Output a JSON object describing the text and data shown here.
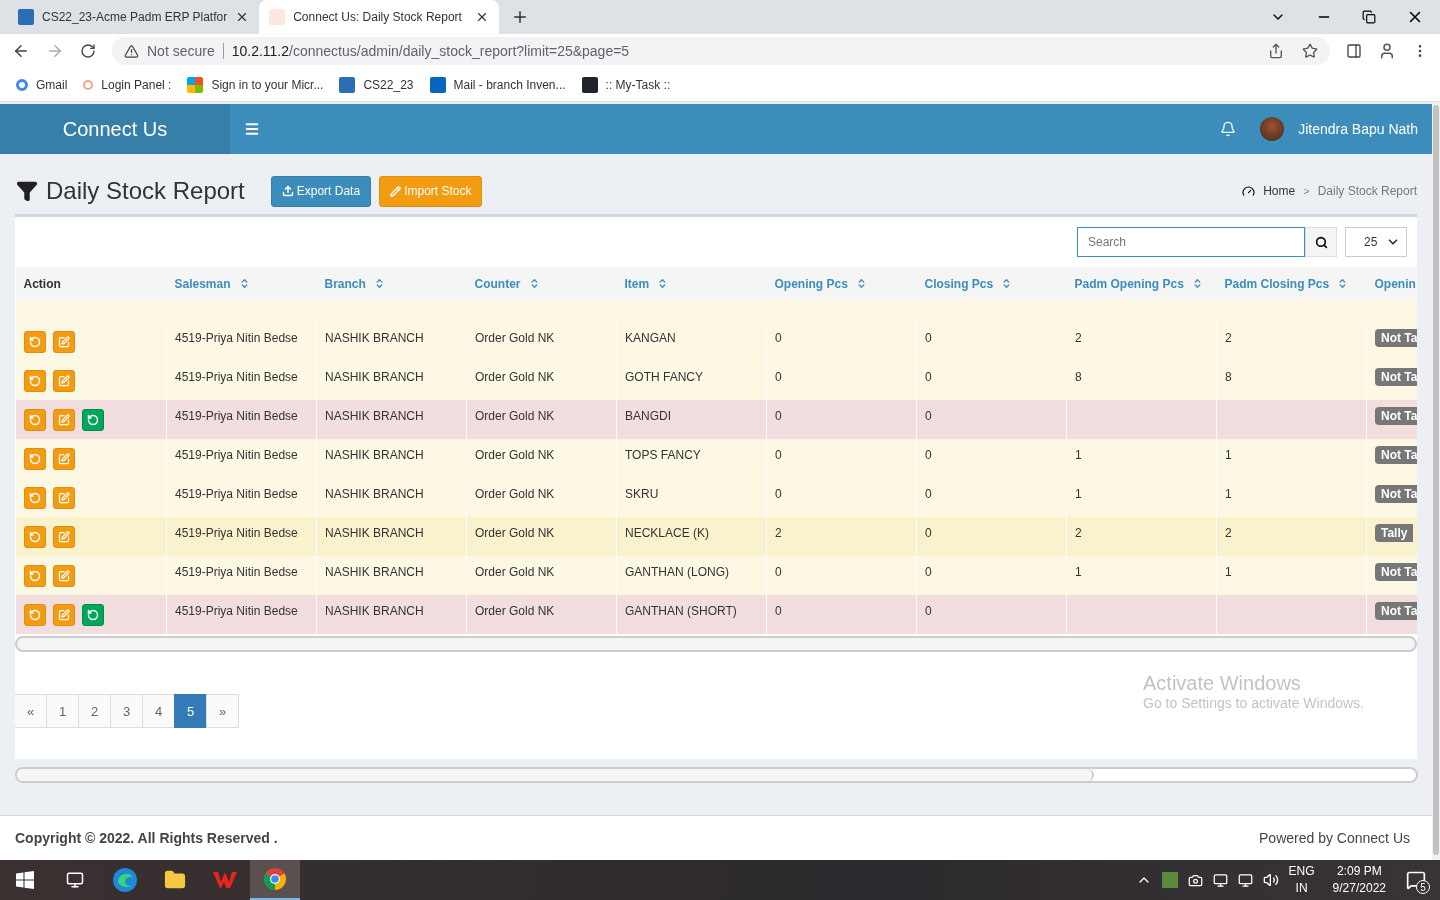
{
  "browser": {
    "tabs": [
      {
        "title": "CS22_23-Acme Padm ERP Platfor",
        "selected": false
      },
      {
        "title": "Connect Us: Daily Stock Report",
        "selected": true
      }
    ],
    "security": "Not secure",
    "url_host": "10.2.11.2",
    "url_path": "/connectus/admin/daily_stock_report?limit=25&page=5",
    "bookmarks": [
      {
        "label": "Gmail",
        "kind": "google"
      },
      {
        "label": "Login Panel :",
        "kind": "connect"
      },
      {
        "label": "Sign in to your Micr...",
        "kind": "microsoft"
      },
      {
        "label": "CS22_23",
        "kind": "erp"
      },
      {
        "label": "Mail - branch Inven...",
        "kind": "outlook"
      },
      {
        "label": ":: My-Task ::",
        "kind": "react"
      }
    ]
  },
  "app": {
    "brand": "Connect Us",
    "user": "Jitendra Bapu Nath"
  },
  "page": {
    "title": "Daily Stock Report",
    "buttons": [
      {
        "label": "Export Data",
        "kind": "export"
      },
      {
        "label": "Import Stock",
        "kind": "import"
      }
    ],
    "breadcrumb": [
      {
        "label": "Home"
      },
      {
        "label": "Daily Stock Report"
      }
    ],
    "breadcrumb_separator": ">"
  },
  "table": {
    "search_placeholder": "Search",
    "page_size": "25",
    "columns": [
      {
        "label": "Action",
        "sortable": false
      },
      {
        "label": "Salesman",
        "sortable": true
      },
      {
        "label": "Branch",
        "sortable": true
      },
      {
        "label": "Counter",
        "sortable": true
      },
      {
        "label": "Item",
        "sortable": true
      },
      {
        "label": "Opening Pcs",
        "sortable": true
      },
      {
        "label": "Closing Pcs",
        "sortable": true
      },
      {
        "label": "Padm Opening Pcs",
        "sortable": true
      },
      {
        "label": "Padm Closing Pcs",
        "sortable": true
      },
      {
        "label": "Openin",
        "sortable": false
      }
    ],
    "rows": [
      {
        "actions": [
          {
            "kind": "reset"
          },
          {
            "kind": "edit"
          }
        ],
        "color": "#fcf8e3",
        "cells": [
          "",
          "4519-Priya Nitin Bedse",
          "NASHIK BRANCH",
          "Order Gold NK",
          "KANGAN",
          "0",
          "0",
          "2",
          "2",
          "Not Ta"
        ]
      },
      {
        "actions": [
          {
            "kind": "reset"
          },
          {
            "kind": "edit"
          }
        ],
        "color": "#fcf8e3",
        "cells": [
          "",
          "4519-Priya Nitin Bedse",
          "NASHIK BRANCH",
          "Order Gold NK",
          "GOTH FANCY",
          "0",
          "0",
          "8",
          "8",
          "Not Ta"
        ]
      },
      {
        "actions": [
          {
            "kind": "reset"
          },
          {
            "kind": "edit"
          },
          {
            "kind": "restore"
          }
        ],
        "color": "#f2dede",
        "cells": [
          "",
          "4519-Priya Nitin Bedse",
          "NASHIK BRANCH",
          "Order Gold NK",
          "BANGDI",
          "0",
          "0",
          "",
          "",
          "Not Ta"
        ]
      },
      {
        "actions": [
          {
            "kind": "reset"
          },
          {
            "kind": "edit"
          }
        ],
        "color": "#fcf8e3",
        "cells": [
          "",
          "4519-Priya Nitin Bedse",
          "NASHIK BRANCH",
          "Order Gold NK",
          "TOPS FANCY",
          "0",
          "0",
          "1",
          "1",
          "Not Ta"
        ]
      },
      {
        "actions": [
          {
            "kind": "reset"
          },
          {
            "kind": "edit"
          }
        ],
        "color": "#fcf8e3",
        "cells": [
          "",
          "4519-Priya Nitin Bedse",
          "NASHIK BRANCH",
          "Order Gold NK",
          "SKRU",
          "0",
          "0",
          "1",
          "1",
          "Not Ta"
        ]
      },
      {
        "actions": [
          {
            "kind": "reset"
          },
          {
            "kind": "edit"
          }
        ],
        "color": "#faf2cc",
        "cells": [
          "",
          "4519-Priya Nitin Bedse",
          "NASHIK BRANCH",
          "Order Gold NK",
          "NECKLACE (K)",
          "2",
          "0",
          "2",
          "2",
          "Tally"
        ]
      },
      {
        "actions": [
          {
            "kind": "reset"
          },
          {
            "kind": "edit"
          }
        ],
        "color": "#fcf8e3",
        "cells": [
          "",
          "4519-Priya Nitin Bedse",
          "NASHIK BRANCH",
          "Order Gold NK",
          "GANTHAN (LONG)",
          "0",
          "0",
          "1",
          "1",
          "Not Ta"
        ]
      },
      {
        "actions": [
          {
            "kind": "reset"
          },
          {
            "kind": "edit"
          },
          {
            "kind": "restore"
          }
        ],
        "color": "#f2dede",
        "cells": [
          "",
          "4519-Priya Nitin Bedse",
          "NASHIK BRANCH",
          "Order Gold NK",
          "GANTHAN (SHORT)",
          "0",
          "0",
          "",
          "",
          "Not Ta"
        ]
      }
    ]
  },
  "pagination": [
    {
      "label": "«",
      "selected": false
    },
    {
      "label": "1",
      "selected": false
    },
    {
      "label": "2",
      "selected": false
    },
    {
      "label": "3",
      "selected": false
    },
    {
      "label": "4",
      "selected": false
    },
    {
      "label": "5",
      "selected": true
    },
    {
      "label": "»",
      "selected": false
    }
  ],
  "activation_notice": {
    "title": "Activate Windows",
    "subtitle": "Go to Settings to activate Windows."
  },
  "footer": {
    "copyright": "Copyright © 2022. All Rights Reserved .",
    "powered_by": "Powered by Connect Us"
  },
  "taskbar": {
    "language": "ENG",
    "region": "IN",
    "time": "2:09 PM",
    "date": "9/27/2022",
    "notifications": "5"
  }
}
